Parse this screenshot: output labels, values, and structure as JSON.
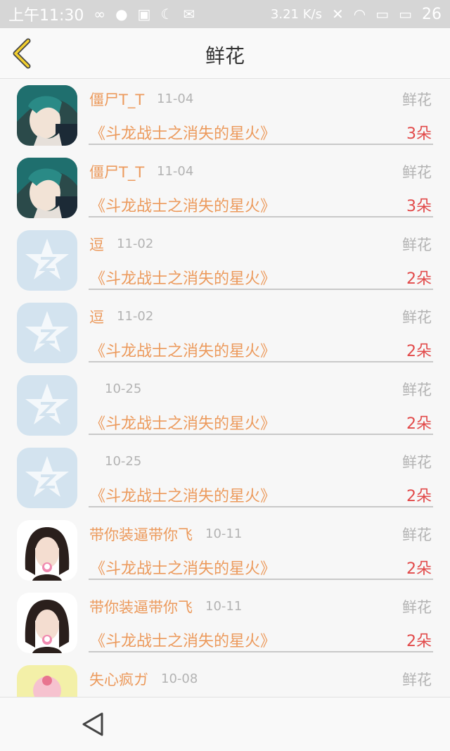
{
  "status_bar": {
    "time": "上午11:30",
    "speed": "3.21 K/s",
    "battery": "26",
    "icons": [
      "infinity-icon",
      "chat-icon",
      "image-icon",
      "moon-icon",
      "mail-icon",
      "mute-icon",
      "wifi-icon",
      "sim-icon",
      "battery-icon"
    ]
  },
  "header": {
    "title": "鲜花",
    "back_icon": "chevron-left-icon"
  },
  "colors": {
    "username": "#ec9a5c",
    "count": "#e24a4a",
    "muted": "#b3b3b3",
    "accent": "#f2cf2f"
  },
  "list": [
    {
      "user": "僵尸T_T",
      "date": "11-04",
      "type": "鲜花",
      "book": "《斗龙战士之消失的星火》",
      "count": "3朵",
      "avatar": "anime-avatar"
    },
    {
      "user": "僵尸T_T",
      "date": "11-04",
      "type": "鲜花",
      "book": "《斗龙战士之消失的星火》",
      "count": "3朵",
      "avatar": "anime-avatar"
    },
    {
      "user": "逗",
      "date": "11-02",
      "type": "鲜花",
      "book": "《斗龙战士之消失的星火》",
      "count": "2朵",
      "avatar": "star-avatar"
    },
    {
      "user": "逗",
      "date": "11-02",
      "type": "鲜花",
      "book": "《斗龙战士之消失的星火》",
      "count": "2朵",
      "avatar": "star-avatar"
    },
    {
      "user": "",
      "date": "10-25",
      "type": "鲜花",
      "book": "《斗龙战士之消失的星火》",
      "count": "2朵",
      "avatar": "star-avatar"
    },
    {
      "user": "",
      "date": "10-25",
      "type": "鲜花",
      "book": "《斗龙战士之消失的星火》",
      "count": "2朵",
      "avatar": "star-avatar"
    },
    {
      "user": "带你装逼带你飞",
      "date": "10-11",
      "type": "鲜花",
      "book": "《斗龙战士之消失的星火》",
      "count": "2朵",
      "avatar": "girl-avatar"
    },
    {
      "user": "带你装逼带你飞",
      "date": "10-11",
      "type": "鲜花",
      "book": "《斗龙战士之消失的星火》",
      "count": "2朵",
      "avatar": "girl-avatar"
    },
    {
      "user": "失心疯ガ",
      "date": "10-08",
      "type": "鲜花",
      "book": "",
      "count": "",
      "avatar": "cupcake-avatar"
    }
  ],
  "bottom_nav": {
    "back_icon": "triangle-back-icon"
  }
}
